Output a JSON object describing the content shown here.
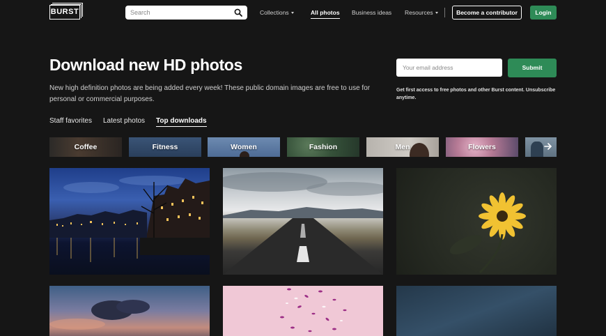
{
  "brand": {
    "logo_text": "BURST"
  },
  "search": {
    "placeholder": "Search"
  },
  "nav": {
    "collections": "Collections",
    "all_photos": "All photos",
    "business_ideas": "Business ideas",
    "resources": "Resources",
    "contributor": "Become a contributor",
    "login": "Login"
  },
  "hero": {
    "title": "Download new HD photos",
    "subtitle": "New high definition photos are being added every week! These public domain images are free to use for personal or commercial purposes.",
    "email_placeholder": "Your email address",
    "submit": "Submit",
    "note": "Get first access to free photos and other Burst content. Unsubscribe anytime."
  },
  "tabs": [
    {
      "label": "Staff favorites",
      "active": false
    },
    {
      "label": "Latest photos",
      "active": false
    },
    {
      "label": "Top downloads",
      "active": true
    }
  ],
  "categories": [
    "Coffee",
    "Fitness",
    "Women",
    "Fashion",
    "Men",
    "Flowers"
  ],
  "colors": {
    "accent": "#2e8b57",
    "background": "#161616"
  }
}
